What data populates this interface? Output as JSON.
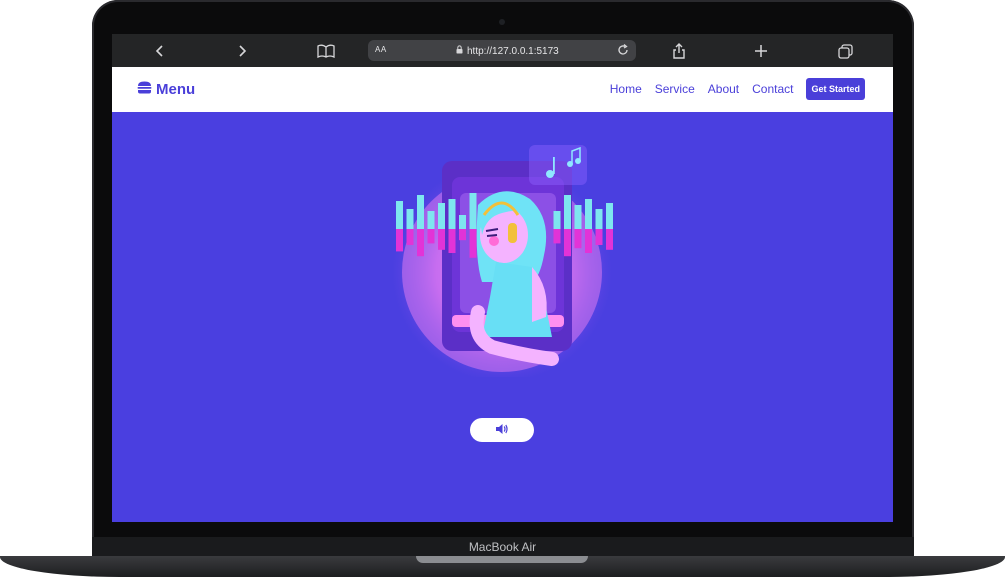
{
  "device": {
    "label": "MacBook Air"
  },
  "browser": {
    "address": {
      "text_size_label": "AA",
      "url": "http://127.0.0.1:5173"
    },
    "icons": [
      "back-icon",
      "forward-icon",
      "book-icon",
      "lock-icon",
      "reload-icon",
      "share-icon",
      "plus-icon",
      "tabs-icon"
    ]
  },
  "site": {
    "brand": {
      "label": "Menu",
      "icon": "burger-icon"
    },
    "nav": [
      {
        "label": "Home"
      },
      {
        "label": "Service"
      },
      {
        "label": "About"
      },
      {
        "label": "Contact"
      }
    ],
    "cta": {
      "label": "Get Started"
    }
  },
  "hero": {
    "illustration": "girl-with-headphones-music-illustration",
    "sound_button": {
      "icon": "speaker-icon"
    }
  },
  "colors": {
    "brand": "#4a3fd9",
    "hero_bg": "#4a3fe0",
    "nav_bg": "#ffffff",
    "toolbar": "#242526"
  }
}
